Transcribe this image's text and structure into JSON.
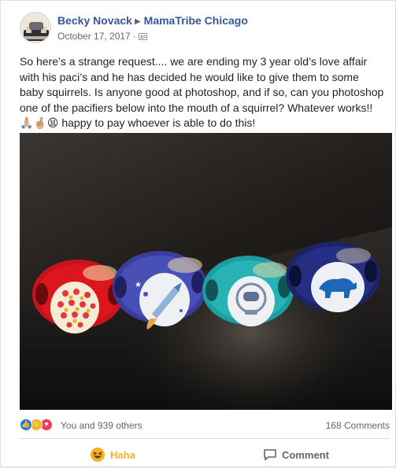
{
  "post": {
    "author": "Becky Novack",
    "group": "MamaTribe Chicago",
    "date": "October 17, 2017",
    "separator": "·",
    "privacy_icon": "members-icon",
    "text": "So here’s a strange request.... we are ending my 3 year old’s love affair with his paci’s and he has decided he would like to give them to some baby squirrels. Is anyone good at photoshop, and if so, can you photoshop one of the pacifiers below into the mouth of a squirrel? Whatever works!! 🙏🏼🤞🏼😫 happy to pay whoever is able to do this!"
  },
  "photo": {
    "pacifiers": [
      {
        "shield_color": "#d6141c",
        "button_design": "polka-dots"
      },
      {
        "shield_color": "#3b3fa0",
        "button_design": "rocket"
      },
      {
        "shield_color": "#23a7a9",
        "button_design": "astronaut"
      },
      {
        "shield_color": "#1f2a73",
        "button_design": "bear"
      }
    ]
  },
  "reactions": {
    "icons": [
      "like-icon",
      "haha-icon",
      "love-icon"
    ],
    "summary": "You and 939 others",
    "comments": "168 Comments"
  },
  "actions": {
    "haha_label": "Haha",
    "comment_label": "Comment"
  },
  "colors": {
    "link": "#365899",
    "haha": "#f7b125",
    "like": "#2078f4",
    "love": "#f33e58"
  }
}
